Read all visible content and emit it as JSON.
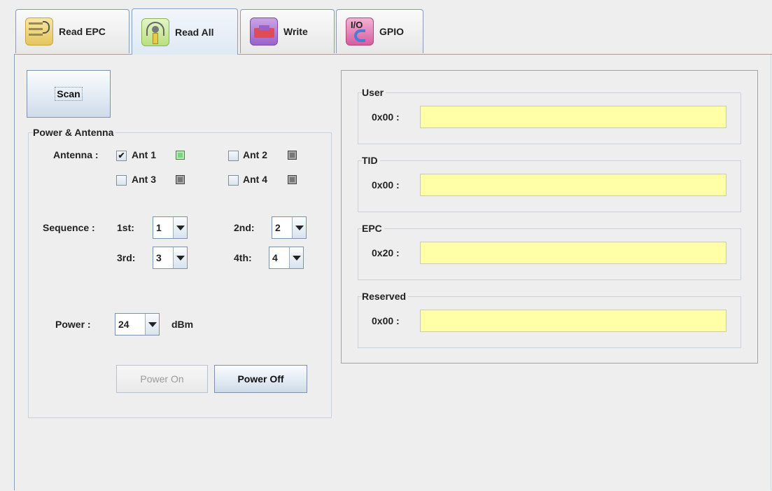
{
  "tabs": [
    {
      "label": "Read EPC",
      "icon": "rfid-tag-icon"
    },
    {
      "label": "Read All",
      "icon": "antenna-signal-icon"
    },
    {
      "label": "Write",
      "icon": "write-tag-icon"
    },
    {
      "label": "GPIO",
      "icon": "io-icon",
      "icon_text": "I/O"
    }
  ],
  "active_tab": "Read All",
  "scan_button": "Scan",
  "power_antenna": {
    "title": "Power & Antenna",
    "antenna_label": "Antenna :",
    "antennas": [
      {
        "label": "Ant 1",
        "checked": true,
        "led": "on"
      },
      {
        "label": "Ant 2",
        "checked": false,
        "led": "off"
      },
      {
        "label": "Ant 3",
        "checked": false,
        "led": "off"
      },
      {
        "label": "Ant 4",
        "checked": false,
        "led": "off"
      }
    ],
    "sequence_label": "Sequence :",
    "sequence": [
      {
        "label": "1st:",
        "value": "1"
      },
      {
        "label": "2nd:",
        "value": "2"
      },
      {
        "label": "3rd:",
        "value": "3"
      },
      {
        "label": "4th:",
        "value": "4"
      }
    ],
    "power_label": "Power :",
    "power_value": "24",
    "power_unit": "dBm",
    "power_on_button": "Power On",
    "power_off_button": "Power Off"
  },
  "memory_banks": [
    {
      "title": "User",
      "address": "0x00 :",
      "value": ""
    },
    {
      "title": "TID",
      "address": "0x00 :",
      "value": ""
    },
    {
      "title": "EPC",
      "address": "0x20 :",
      "value": ""
    },
    {
      "title": "Reserved",
      "address": "0x00 :",
      "value": ""
    }
  ],
  "colors": {
    "field_background": "#ffffa8",
    "led_on": "#7fd07f",
    "led_off": "#777777",
    "accent_border": "#8aa0bb"
  }
}
